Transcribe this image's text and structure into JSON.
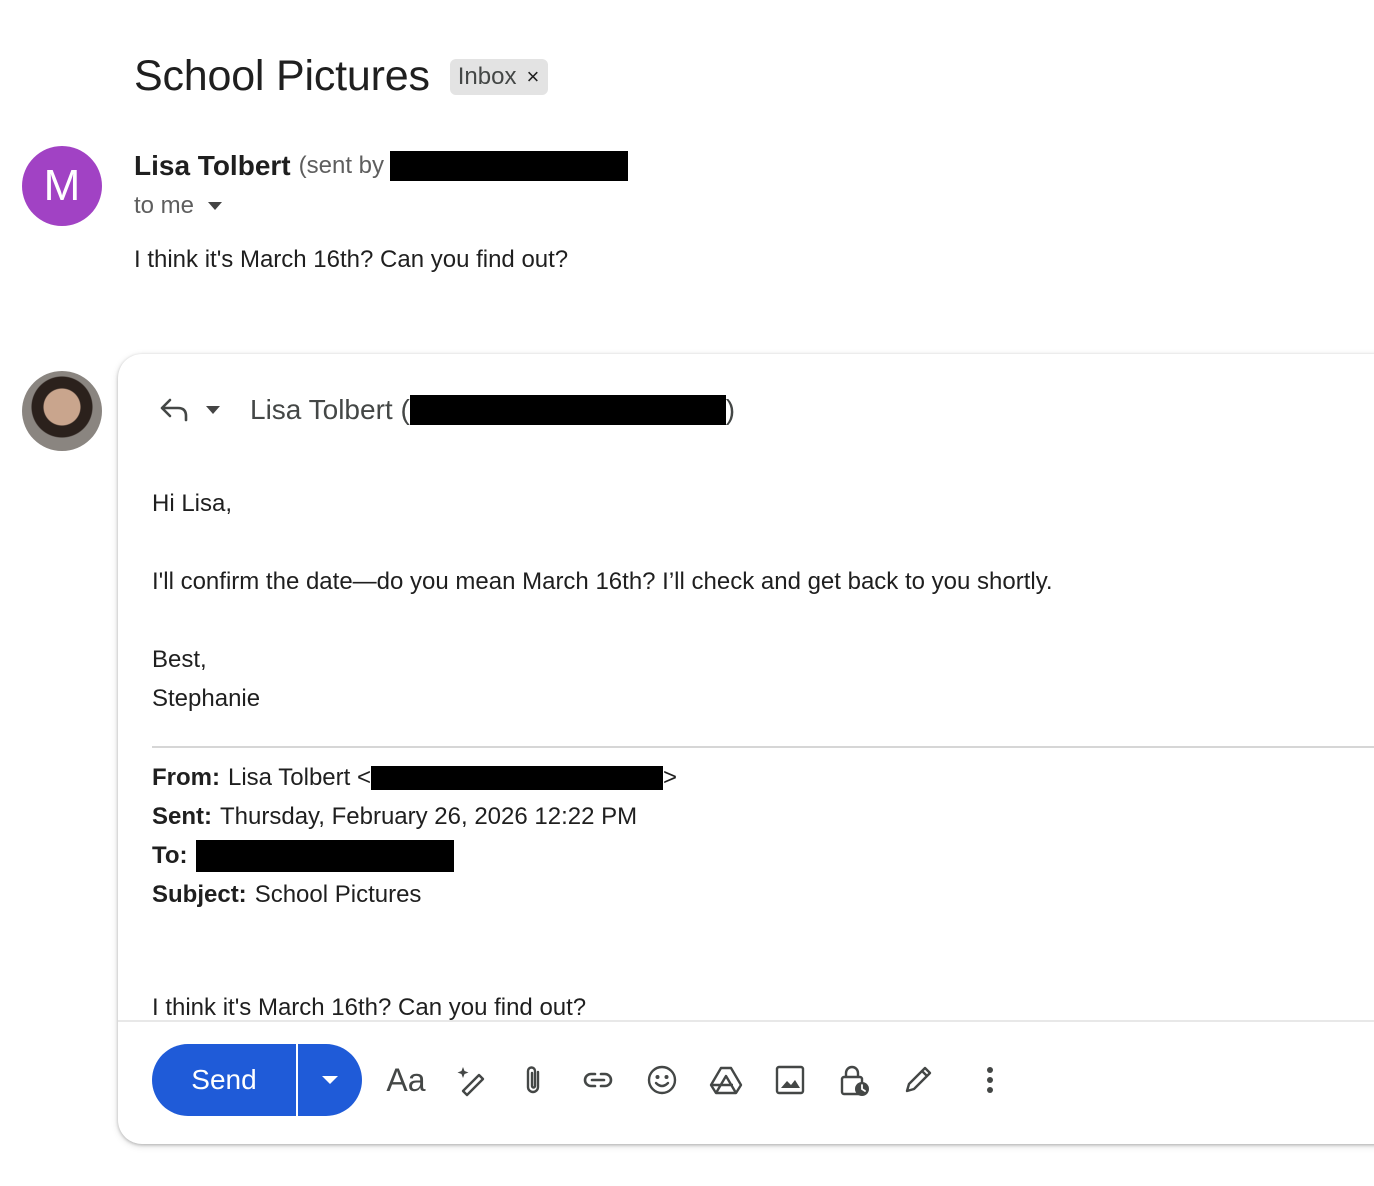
{
  "thread": {
    "subject": "School Pictures",
    "label": "Inbox",
    "label_remove": "×"
  },
  "message": {
    "avatar_letter": "M",
    "avatar_color": "#a142c4",
    "sender_name": "Lisa Tolbert",
    "sent_by_prefix": "(sent by",
    "to_label": "to me",
    "body": "I think it's March 16th? Can you find out?"
  },
  "reply": {
    "recipient_name": "Lisa Tolbert (",
    "recipient_close": ")",
    "greeting": "Hi Lisa,",
    "body": "I'll confirm the date—do you mean March 16th? I’ll check and get back to you shortly.",
    "signoff": "Best,",
    "signature": "Stephanie",
    "quoted": {
      "from_label": "From:",
      "from_name": "Lisa Tolbert <",
      "from_close": ">",
      "sent_label": "Sent:",
      "sent_value": "Thursday, February 26, 2026 12:22 PM",
      "to_label": "To:",
      "subject_label": "Subject:",
      "subject_value": "School Pictures",
      "body": "I think it's March 16th? Can you find out?"
    }
  },
  "toolbar": {
    "send_label": "Send",
    "format_label": "Aa",
    "accent_color": "#1f5bd8",
    "icons": [
      "reply-icon",
      "ai-write-icon",
      "attach-icon",
      "link-icon",
      "emoji-icon",
      "drive-icon",
      "photo-icon",
      "confidential-icon",
      "signature-icon",
      "more-options-icon"
    ]
  }
}
